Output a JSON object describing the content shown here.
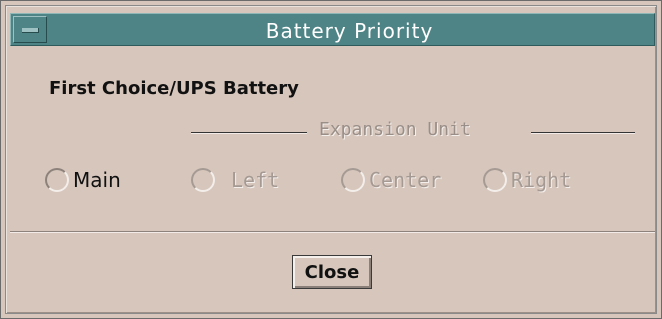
{
  "window": {
    "title": "Battery Priority"
  },
  "heading": "First Choice/UPS Battery",
  "expansion_group": {
    "title": "Expansion Unit"
  },
  "radios": [
    {
      "label": "Main",
      "enabled": true,
      "checked": false
    },
    {
      "label": "Left",
      "enabled": false,
      "checked": false
    },
    {
      "label": "Center",
      "enabled": false,
      "checked": false
    },
    {
      "label": "Right",
      "enabled": false,
      "checked": false
    }
  ],
  "buttons": {
    "close_label": "Close"
  },
  "colors": {
    "titlebar": "#4f8486",
    "background": "#d6c6bc",
    "disabled_text": "#a59a93"
  }
}
